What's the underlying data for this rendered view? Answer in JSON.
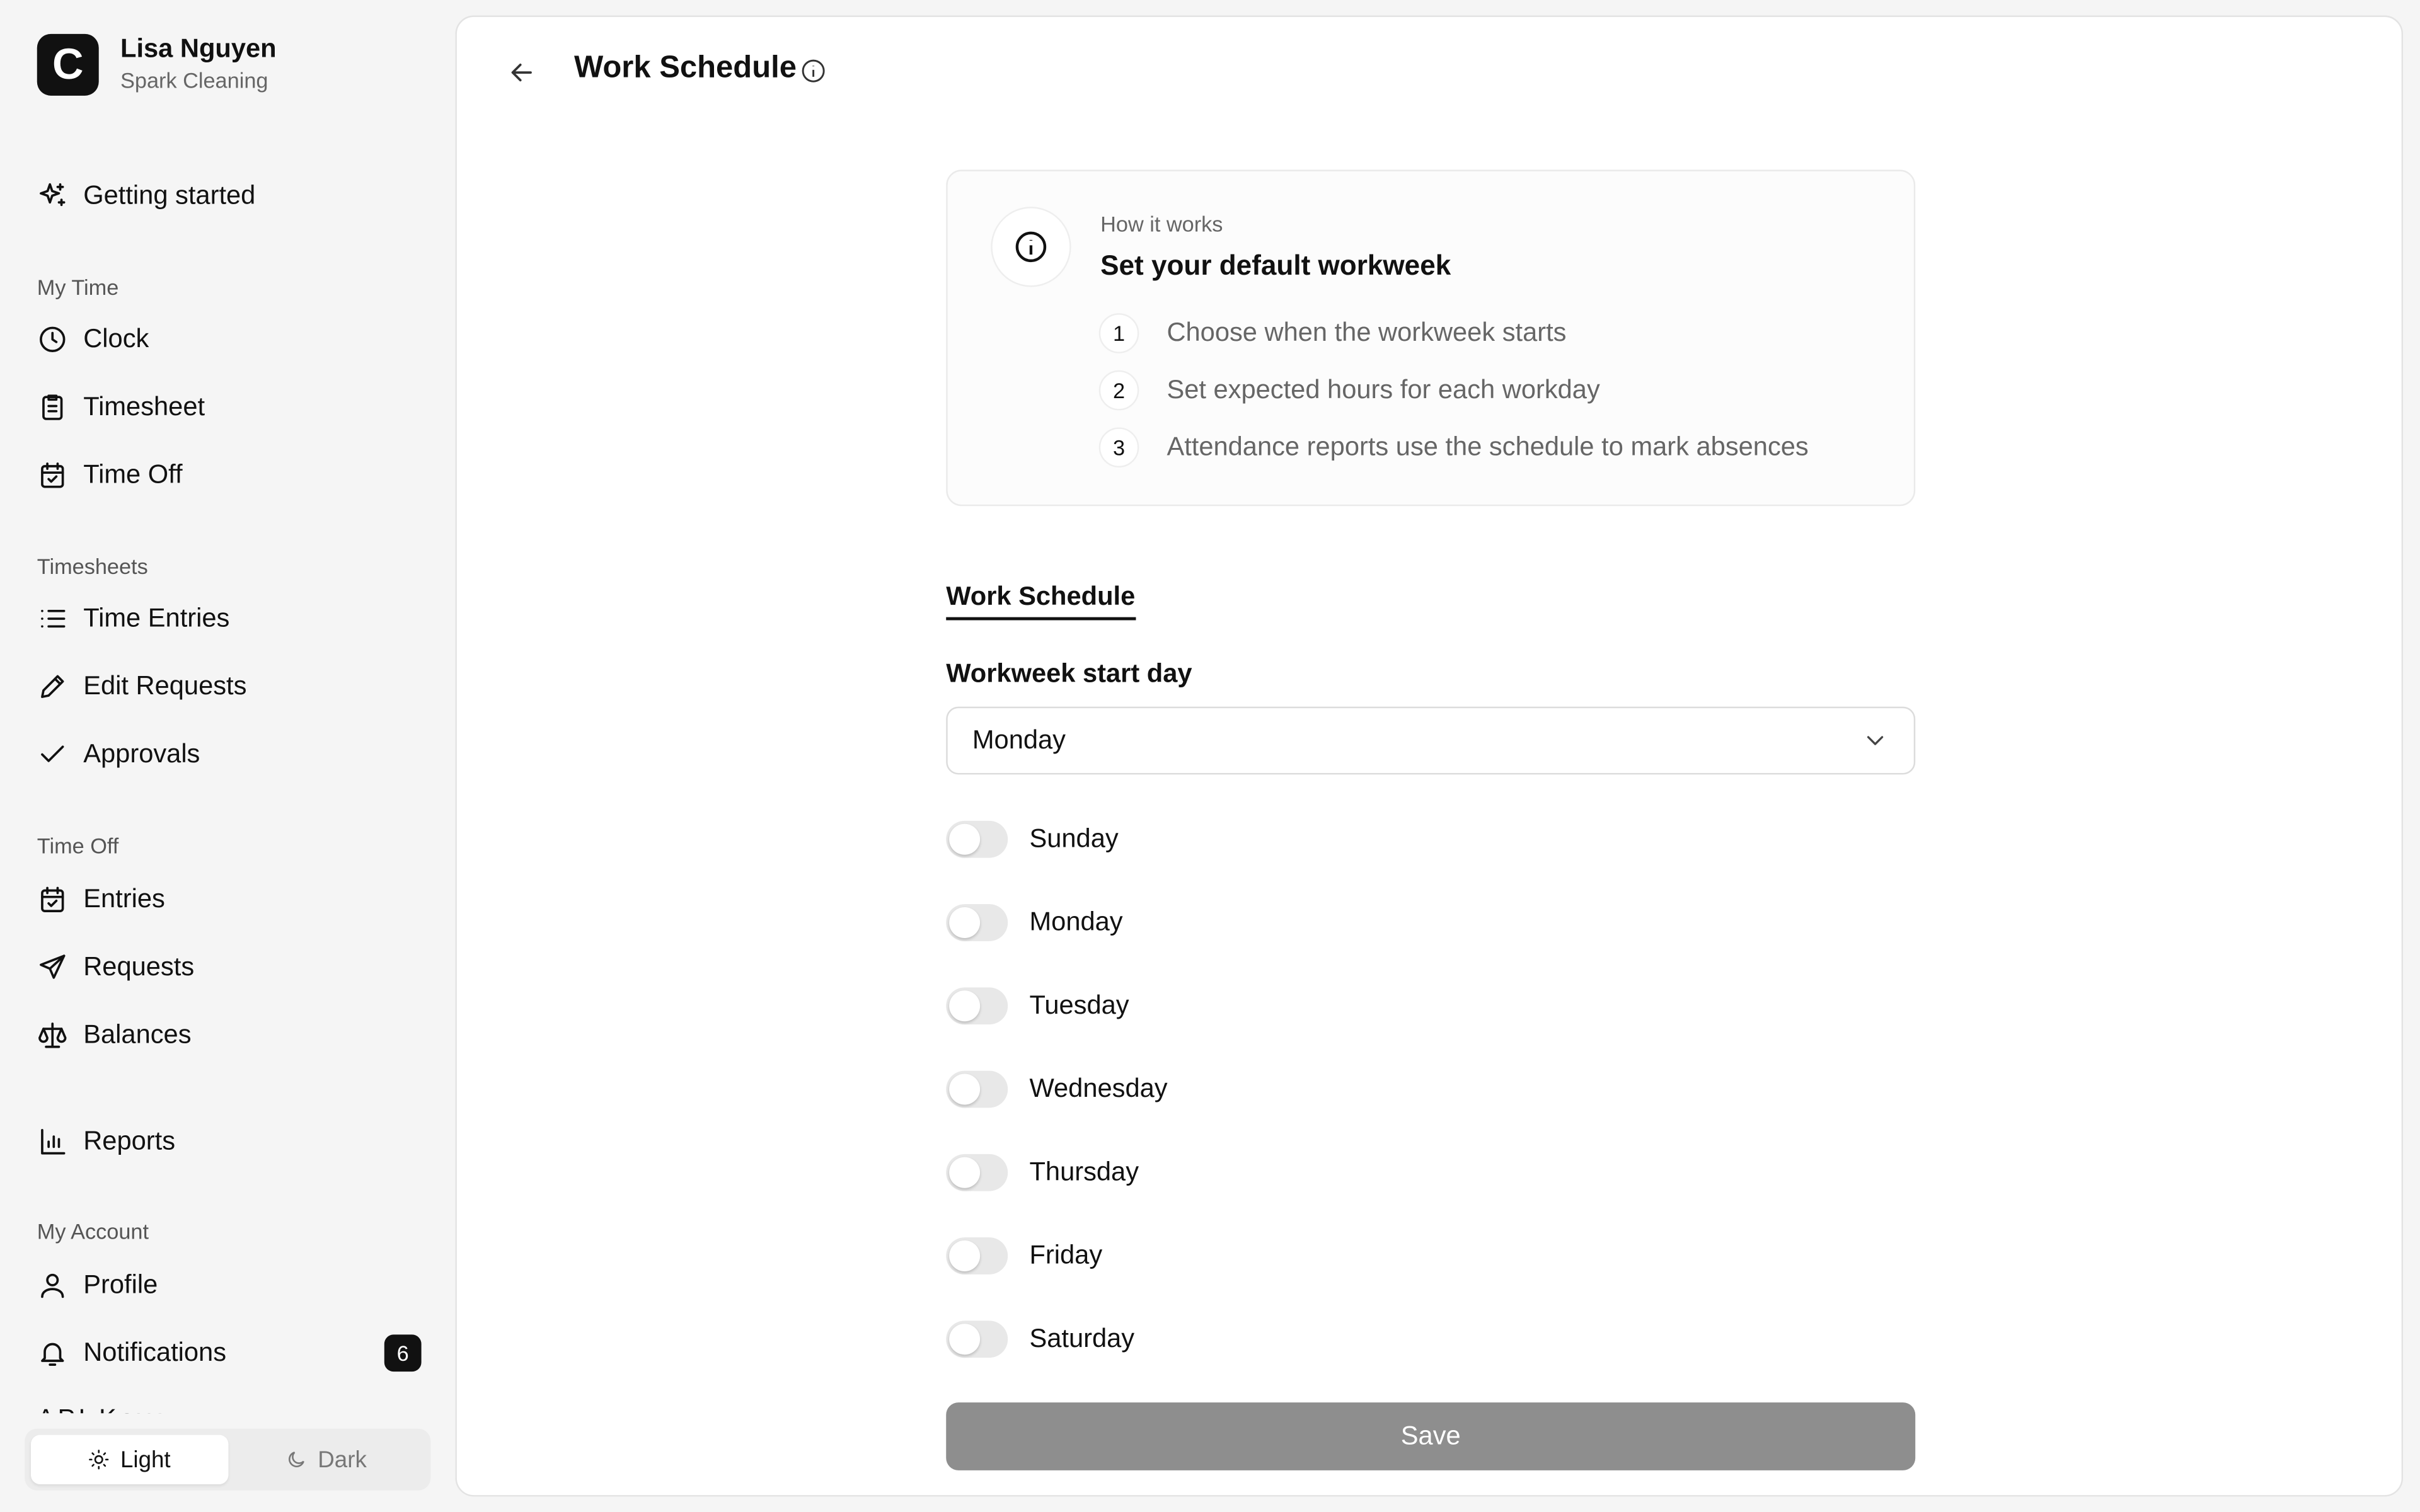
{
  "user": {
    "initial": "C",
    "name": "Lisa Nguyen",
    "org": "Spark Cleaning"
  },
  "nav": {
    "getting_started": "Getting started",
    "my_time": {
      "label": "My Time",
      "items": [
        "Clock",
        "Timesheet",
        "Time Off"
      ]
    },
    "timesheets": {
      "label": "Timesheets",
      "items": [
        "Time Entries",
        "Edit Requests",
        "Approvals"
      ]
    },
    "time_off": {
      "label": "Time Off",
      "items": [
        "Entries",
        "Requests",
        "Balances"
      ]
    },
    "reports": "Reports",
    "my_account": {
      "label": "My Account",
      "items": [
        "Profile",
        "Notifications"
      ]
    },
    "notifications_count": "6",
    "clipped_item": "API Keys"
  },
  "theme": {
    "light": "Light",
    "dark": "Dark",
    "selected": "Light"
  },
  "page": {
    "title": "Work Schedule"
  },
  "info_card": {
    "eyebrow": "How it works",
    "title": "Set your default workweek",
    "steps": [
      {
        "num": "1",
        "text": "Choose when the workweek starts"
      },
      {
        "num": "2",
        "text": "Set expected hours for each workday"
      },
      {
        "num": "3",
        "text": "Attendance reports use the schedule to mark absences"
      }
    ]
  },
  "tab": "Work Schedule",
  "form": {
    "start_day_label": "Workweek start day",
    "start_day_value": "Monday",
    "days": [
      {
        "label": "Sunday",
        "enabled": false
      },
      {
        "label": "Monday",
        "enabled": false
      },
      {
        "label": "Tuesday",
        "enabled": false
      },
      {
        "label": "Wednesday",
        "enabled": false
      },
      {
        "label": "Thursday",
        "enabled": false
      },
      {
        "label": "Friday",
        "enabled": false
      },
      {
        "label": "Saturday",
        "enabled": false
      }
    ],
    "save_label": "Save"
  }
}
